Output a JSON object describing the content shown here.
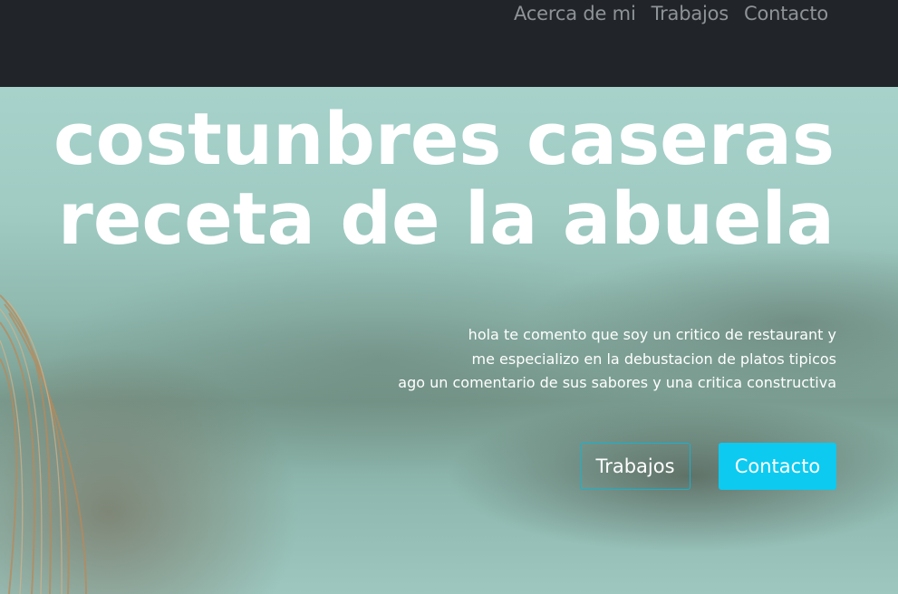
{
  "nav": {
    "links": [
      {
        "label": "Acerca de mi"
      },
      {
        "label": "Trabajos"
      },
      {
        "label": "Contacto"
      }
    ]
  },
  "hero": {
    "title_line1": "costunbres caseras",
    "title_line2": "receta de la abuela",
    "text_line1": "hola te comento que soy un critico de restaurant y",
    "text_line2": "me especializo en la debustacion de platos tipicos",
    "text_line3": "ago un comentario de sus sabores y una critica constructiva",
    "buttons": {
      "trabajos": "Trabajos",
      "contacto": "Contacto"
    }
  },
  "colors": {
    "navbar": "#212529",
    "nav_link": "#8e9398",
    "accent": "#0dcaf0"
  }
}
